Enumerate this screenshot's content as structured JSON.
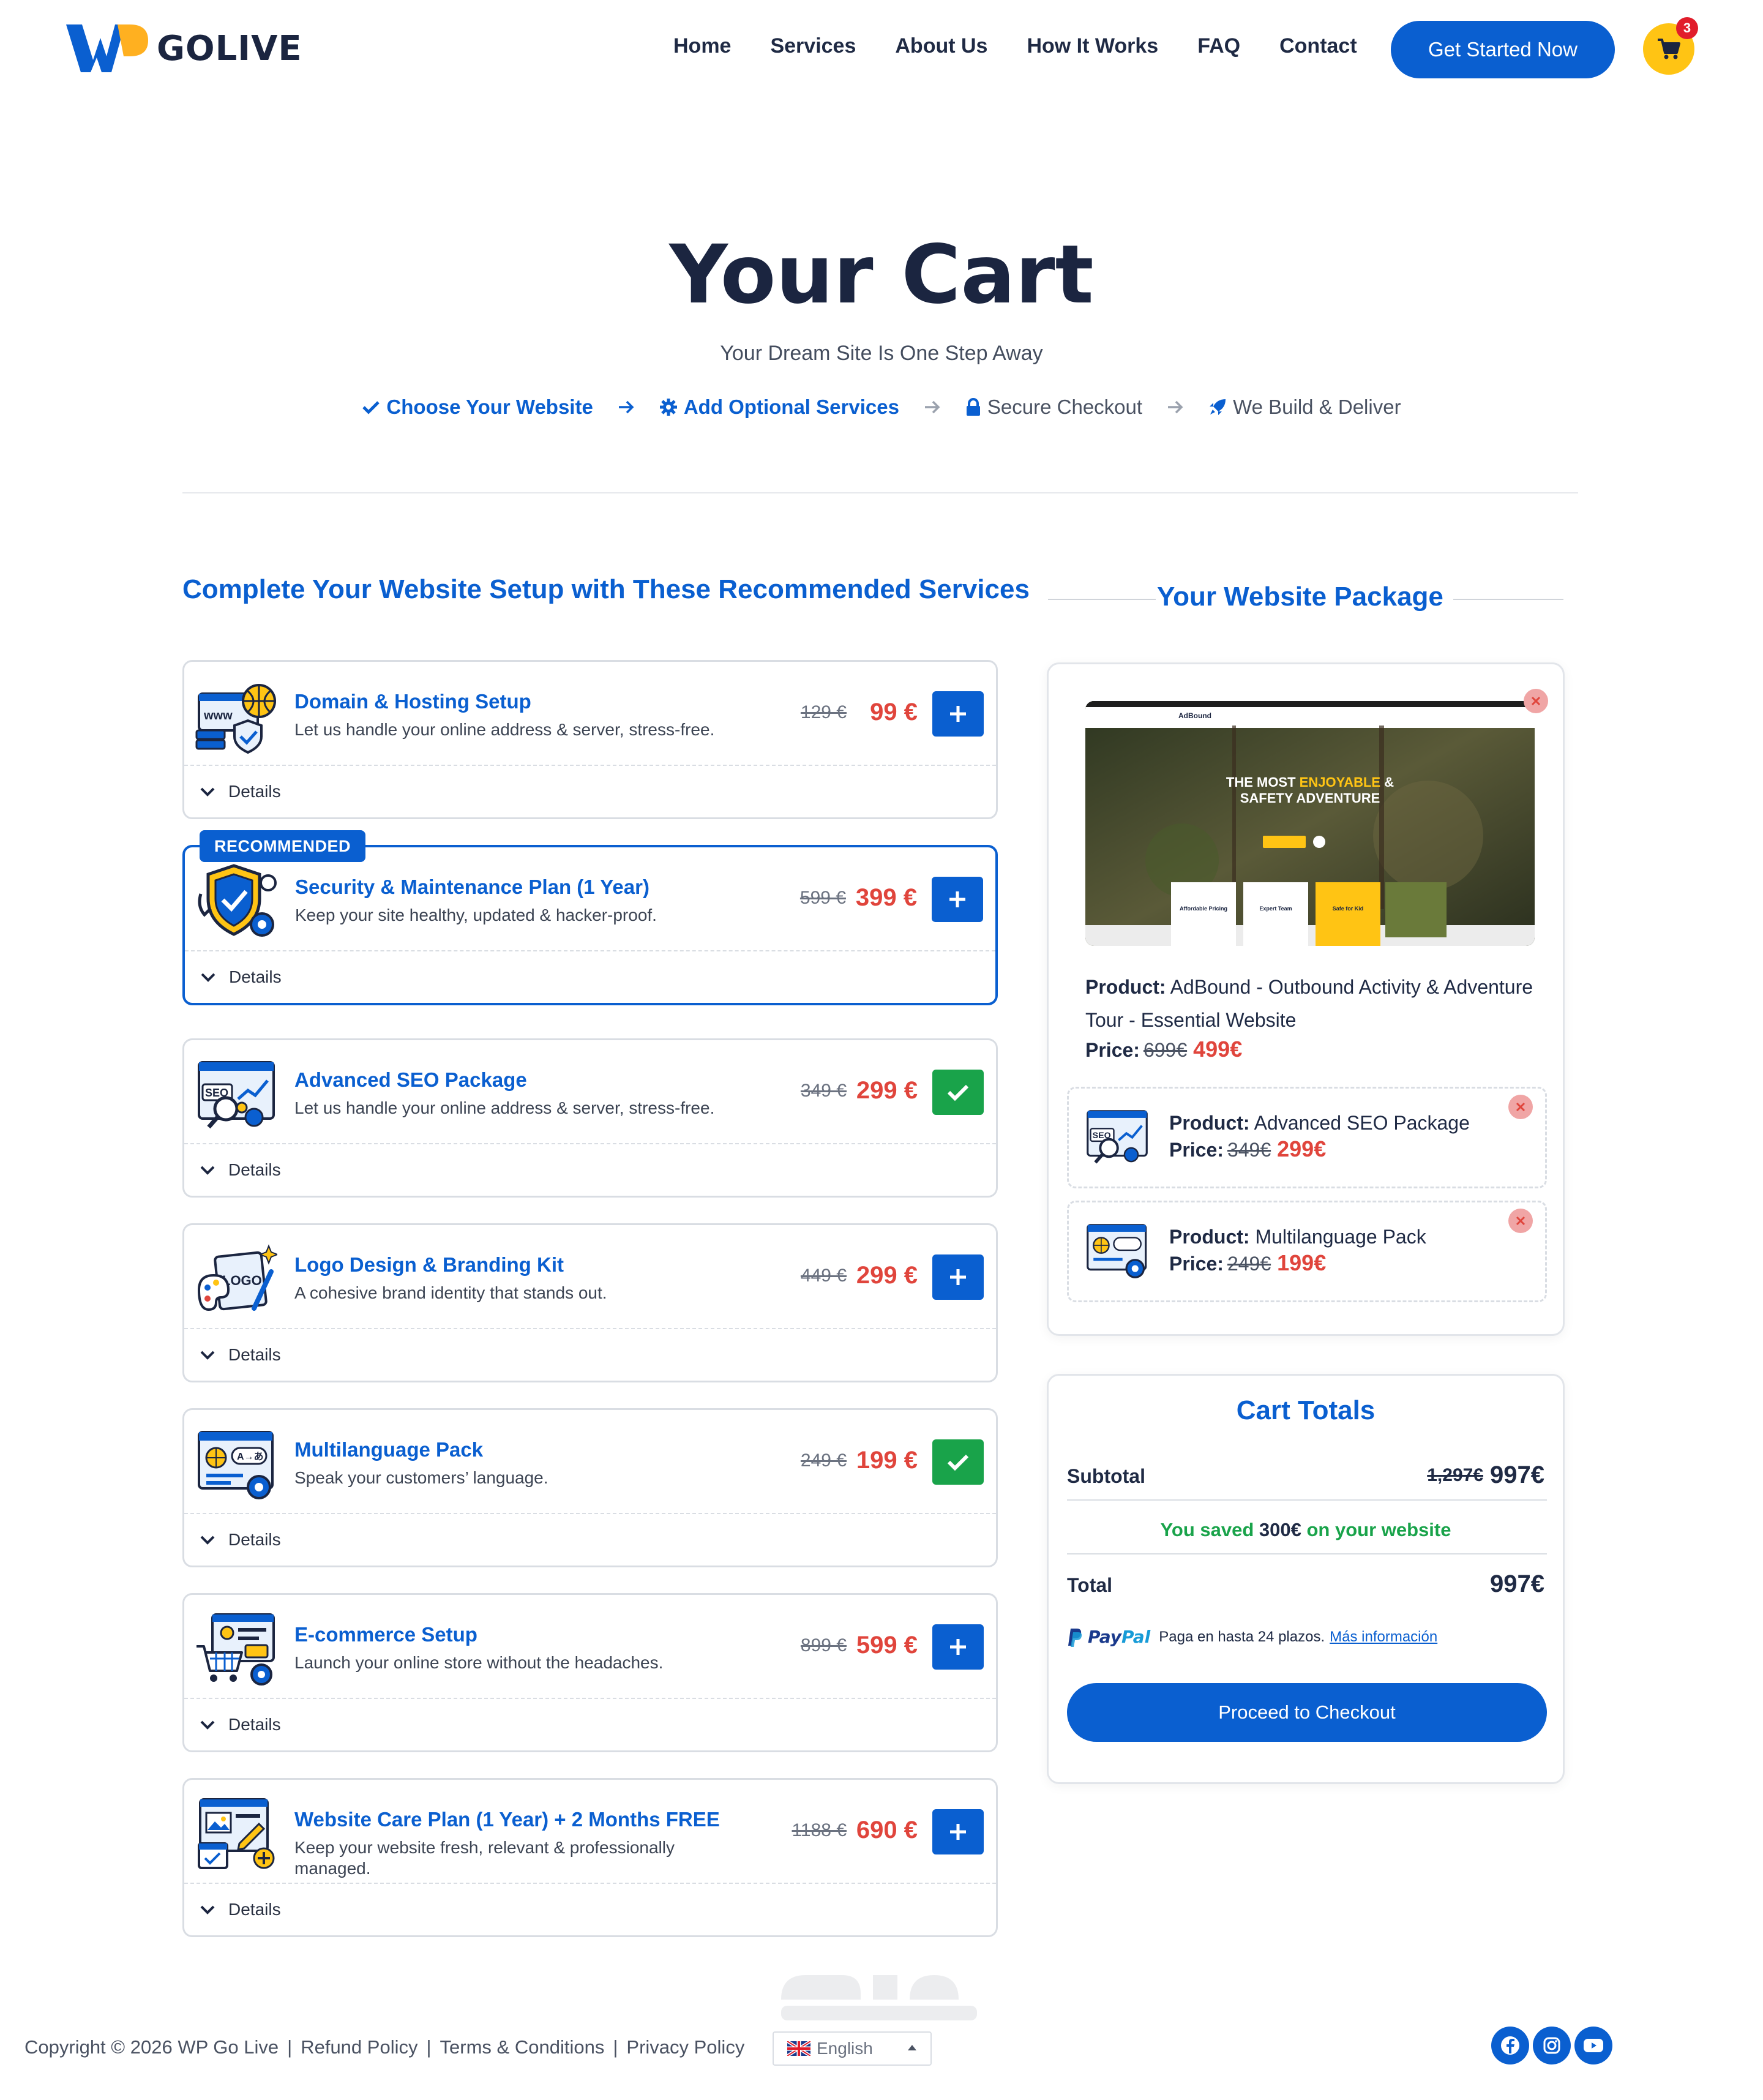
{
  "brand": {
    "name": "GOLIVE",
    "accent": "#0a5fd0",
    "logo_yellow": "#ffc414"
  },
  "nav": {
    "items": [
      "Home",
      "Services",
      "About Us",
      "How It Works",
      "FAQ",
      "Contact"
    ],
    "cta": "Get Started Now",
    "cart_count": "3",
    "cart_icon": "shopping-cart-icon"
  },
  "hero": {
    "title": "Your Cart",
    "subtitle": "Your Dream Site Is One Step Away"
  },
  "steps": [
    {
      "label": "Choose Your Website",
      "icon": "check-icon",
      "state": "done"
    },
    {
      "label": "Add Optional Services",
      "icon": "gear-icon",
      "state": "done"
    },
    {
      "label": "Secure Checkout",
      "icon": "lock-icon",
      "state": "todo"
    },
    {
      "label": "We Build & Deliver",
      "icon": "rocket-icon",
      "state": "todo"
    }
  ],
  "services_heading": "Complete Your Website Setup with These Recommended Services",
  "services": [
    {
      "title": "Domain & Hosting Setup",
      "desc": "Let us handle your online address & server, stress-free.",
      "old_price": "129 €",
      "price": "99 €",
      "added": false,
      "details": "Details",
      "icon": "domain-hosting-icon"
    },
    {
      "title": "Security & Maintenance Plan (1 Year)",
      "desc": "Keep your site healthy, updated & hacker-proof.",
      "old_price": "599 €",
      "price": "399 €",
      "added": false,
      "details": "Details",
      "badge": "RECOMMENDED",
      "icon": "security-shield-icon"
    },
    {
      "title": "Advanced SEO Package",
      "desc": "Let us handle your online address & server, stress-free.",
      "old_price": "349 €",
      "price": "299 €",
      "added": true,
      "details": "Details",
      "icon": "seo-icon"
    },
    {
      "title": "Logo Design & Branding Kit",
      "desc": "A cohesive brand identity that stands out.",
      "old_price": "449 €",
      "price": "299 €",
      "added": false,
      "details": "Details",
      "icon": "logo-palette-icon"
    },
    {
      "title": "Multilanguage Pack",
      "desc": "Speak your customers’ language.",
      "old_price": "249 €",
      "price": "199 €",
      "added": true,
      "details": "Details",
      "icon": "multilanguage-icon"
    },
    {
      "title": "E-commerce Setup",
      "desc": "Launch your online store without the headaches.",
      "old_price": "899 €",
      "price": "599 €",
      "added": false,
      "details": "Details",
      "icon": "ecommerce-cart-icon"
    },
    {
      "title": "Website Care Plan (1 Year) + 2 Months FREE",
      "desc": "Keep your website fresh, relevant & professionally managed.",
      "old_price": "1188 €",
      "price": "690 €",
      "added": false,
      "details": "Details",
      "icon": "website-care-icon"
    }
  ],
  "package": {
    "heading": "Your Website Package",
    "preview": {
      "site_logo": "AdBound",
      "headline_1": "THE MOST ",
      "headline_accent": "ENJOYABLE",
      "headline_2": " &",
      "headline_3": "SAFETY ADVENTURE",
      "features": [
        "Affordable Pricing",
        "Expert Team",
        "Safe for Kid"
      ]
    },
    "product_label": "Product:",
    "product_name": "AdBound - Outbound Activity & Adventure Tour - Essential Website",
    "price_label": "Price:",
    "old_price": "699€",
    "price": "499€",
    "addons": [
      {
        "product_label": "Product:",
        "name": "Advanced SEO Package",
        "price_label": "Price:",
        "old_price": "349€",
        "price": "299€",
        "icon": "seo-icon"
      },
      {
        "product_label": "Product:",
        "name": "Multilanguage Pack",
        "price_label": "Price:",
        "old_price": "249€",
        "price": "199€",
        "icon": "multilanguage-icon"
      }
    ]
  },
  "totals": {
    "title": "Cart Totals",
    "subtotal_label": "Subtotal",
    "subtotal_old": "1,297€",
    "subtotal": "997€",
    "saved_prefix": "You saved ",
    "saved_amount": "300€",
    "saved_suffix": " on your website",
    "total_label": "Total",
    "total": "997€",
    "paypal_brand_1": "Pay",
    "paypal_brand_2": "Pal",
    "paypal_text": "Paga en hasta 24 plazos.",
    "paypal_link": "Más información",
    "checkout": "Proceed to Checkout"
  },
  "footer": {
    "copyright": "Copyright © 2026 WP Go Live",
    "links": [
      "Refund Policy",
      "Terms & Conditions",
      "Privacy Policy"
    ],
    "language": "English",
    "social": [
      "facebook-icon",
      "instagram-icon",
      "youtube-icon"
    ]
  }
}
